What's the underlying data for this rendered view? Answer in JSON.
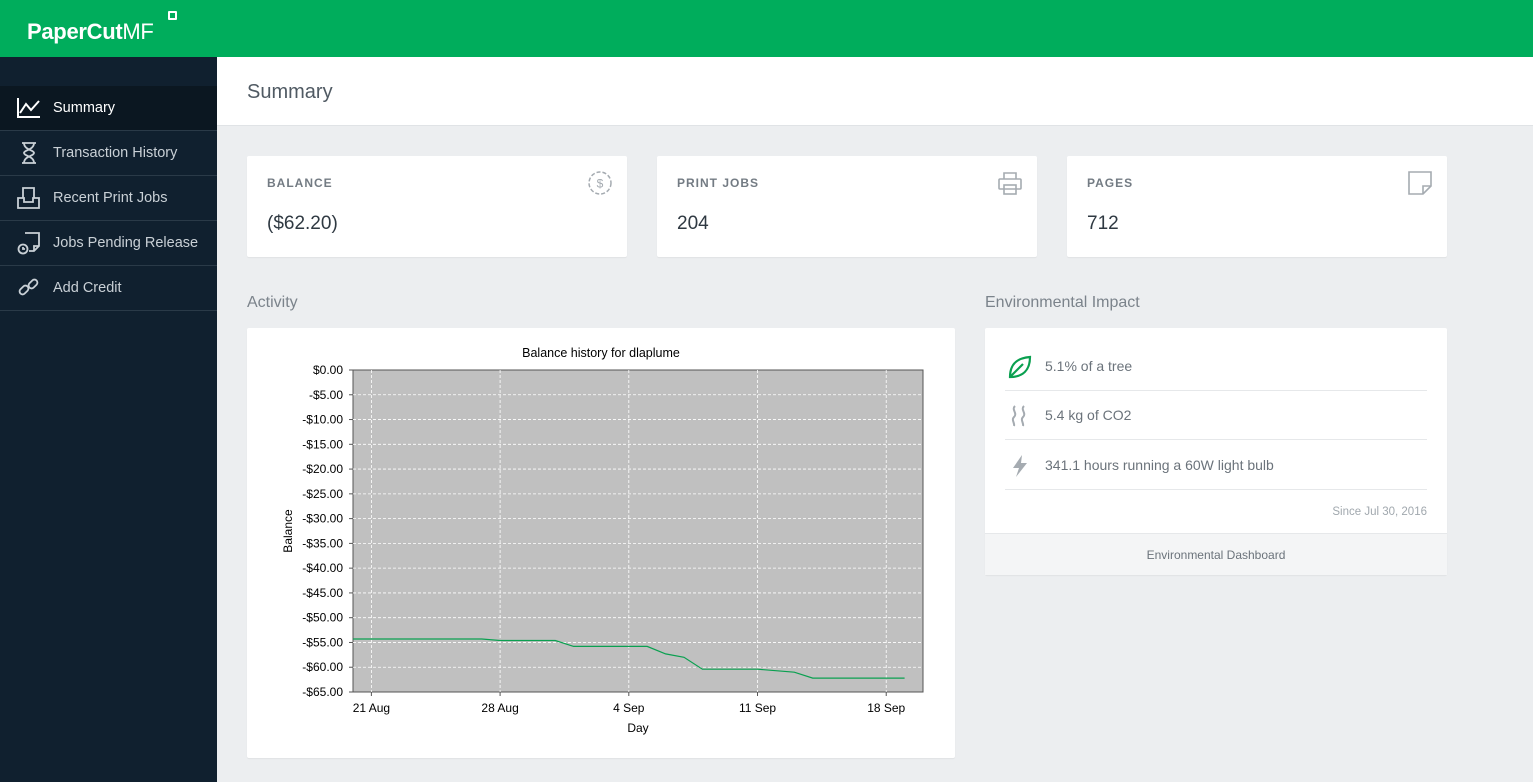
{
  "app": {
    "brand": "PaperCut",
    "brand_suffix": "MF"
  },
  "nav": {
    "items": [
      {
        "label": "Summary",
        "icon": "line-chart-icon",
        "active": true
      },
      {
        "label": "Transaction History",
        "icon": "hourglass-icon"
      },
      {
        "label": "Recent Print Jobs",
        "icon": "print-tray-icon"
      },
      {
        "label": "Jobs Pending Release",
        "icon": "pending-document-icon"
      },
      {
        "label": "Add Credit",
        "icon": "link-icon"
      }
    ]
  },
  "page": {
    "title": "Summary"
  },
  "stats": [
    {
      "label": "BALANCE",
      "value": "($62.20)",
      "icon": "dollar-circle-icon"
    },
    {
      "label": "PRINT JOBS",
      "value": "204",
      "icon": "printer-icon"
    },
    {
      "label": "PAGES",
      "value": "712",
      "icon": "page-icon"
    }
  ],
  "activity": {
    "title": "Activity"
  },
  "environment": {
    "title": "Environmental Impact",
    "rows": [
      {
        "text": "5.1% of a tree",
        "icon": "leaf-icon"
      },
      {
        "text": "5.4 kg of CO2",
        "icon": "smoke-icon"
      },
      {
        "text": "341.1 hours running a 60W light bulb",
        "icon": "lightning-icon"
      }
    ],
    "since": "Since Jul 30, 2016",
    "footer_link": "Environmental Dashboard"
  },
  "colors": {
    "brand_green": "#00ad5c",
    "sidebar_bg": "#10202f",
    "plot_bg": "#c0c0c0",
    "series_line": "#0aa050"
  },
  "chart_data": {
    "type": "line",
    "title": "Balance history for dlaplume",
    "xlabel": "Day",
    "ylabel": "Balance",
    "ylim": [
      -65,
      0
    ],
    "y_ticks": [
      "$0.00",
      "-$5.00",
      "-$10.00",
      "-$15.00",
      "-$20.00",
      "-$25.00",
      "-$30.00",
      "-$35.00",
      "-$40.00",
      "-$45.00",
      "-$50.00",
      "-$55.00",
      "-$60.00",
      "-$65.00"
    ],
    "x_ticks": [
      "21 Aug",
      "28 Aug",
      "4 Sep",
      "11 Sep",
      "18 Sep"
    ],
    "x_tick_dates": [
      "2016-08-21",
      "2016-08-28",
      "2016-09-04",
      "2016-09-11",
      "2016-09-18"
    ],
    "xlim": [
      "2016-08-20",
      "2016-09-20"
    ],
    "grid": true,
    "series": [
      {
        "x": [
          "2016-08-20",
          "2016-08-27",
          "2016-08-28",
          "2016-08-31",
          "2016-09-01",
          "2016-09-05",
          "2016-09-06",
          "2016-09-07",
          "2016-09-08",
          "2016-09-11",
          "2016-09-13",
          "2016-09-14",
          "2016-09-19"
        ],
        "y": [
          -54.3,
          -54.3,
          -54.6,
          -54.6,
          -55.8,
          -55.8,
          -57.3,
          -58.0,
          -60.4,
          -60.4,
          -61.0,
          -62.2,
          -62.2
        ]
      }
    ]
  }
}
